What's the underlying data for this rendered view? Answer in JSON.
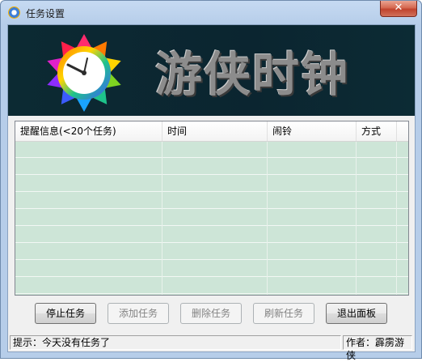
{
  "window": {
    "title": "任务设置",
    "close_label": "✕"
  },
  "banner": {
    "title": "游侠时钟"
  },
  "table": {
    "columns": [
      "提醒信息(<20个任务)",
      "时间",
      "闹铃",
      "方式"
    ],
    "rows": []
  },
  "buttons": {
    "stop": "停止任务",
    "add": "添加任务",
    "delete": "删除任务",
    "refresh": "刷新任务",
    "exit": "退出面板"
  },
  "status": {
    "hint": "提示：今天没有任务了",
    "author": "作者：霹雳游侠"
  },
  "colors": {
    "grid_bg": "#cde5d7",
    "banner_bg": "#0c2a33"
  }
}
